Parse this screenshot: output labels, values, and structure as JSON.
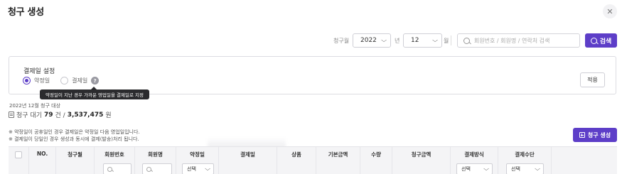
{
  "header": {
    "title": "청구 생성",
    "close_icon": "close-icon"
  },
  "filter": {
    "month_label": "청구월",
    "year_value": "2022",
    "year_unit": "년",
    "month_value": "12",
    "month_unit": "월",
    "search_placeholder": "회원번호 / 회원명 / 연락처 검색",
    "search_button": "검색"
  },
  "settings": {
    "title": "결제일 설정",
    "options": [
      {
        "label": "약정일",
        "selected": true
      },
      {
        "label": "결제일",
        "selected": false
      }
    ],
    "help_glyph": "?",
    "tooltip": "약정일이 지난 경우 가까운 영업일을 결제일로 지정",
    "apply_button": "적용"
  },
  "summary": {
    "period": "2022년 12월 청구 대상",
    "prefix": "청구 대기",
    "count": "79",
    "count_unit": "건 /",
    "amount": "3,537,475",
    "amount_unit": "원"
  },
  "notes": [
    "※ 약정일이 공휴일인 경우 결제일은 약정일 다음 영업일입니다.",
    "※ 결제일이 당일인 경우 생성과 동시에 결제(발송)처리 됩니다."
  ],
  "create_button": "청구 생성",
  "table": {
    "columns": [
      "NO.",
      "청구월",
      "회원번호",
      "회원명",
      "약정일",
      "결제일",
      "상품",
      "기본금액",
      "수량",
      "청구금액",
      "결제방식",
      "결제수단"
    ],
    "select_placeholder": "선택"
  },
  "colors": {
    "accent": "#5d3ec8",
    "header_bg": "#f4f4f6"
  }
}
